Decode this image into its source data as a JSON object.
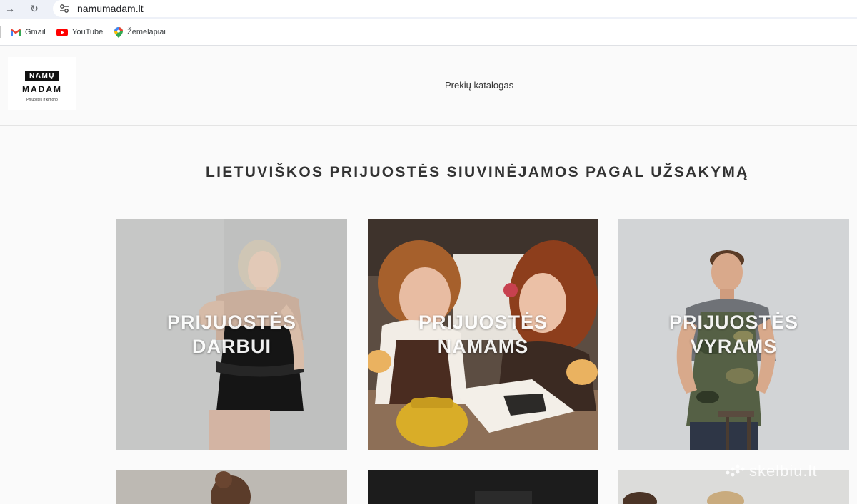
{
  "browser": {
    "url": "namumadam.lt",
    "bookmarks": [
      {
        "label": "Gmail",
        "icon": "gmail-icon"
      },
      {
        "label": "YouTube",
        "icon": "youtube-icon"
      },
      {
        "label": "Žemėlapiai",
        "icon": "maps-pin-icon"
      }
    ]
  },
  "header": {
    "logo": {
      "top": "NAMŲ",
      "main": "MADAM",
      "sub": "Prijuostės ir kimono"
    },
    "nav_link": "Prekių katalogas"
  },
  "main": {
    "headline": "LIETUVIŠKOS PRIJUOSTĖS SIUVINĖJAMOS PAGAL UŽSAKYMĄ",
    "categories": [
      {
        "line1": "PRIJUOSTĖS",
        "line2": "DARBUI"
      },
      {
        "line1": "PRIJUOSTĖS",
        "line2": "NAMAMS"
      },
      {
        "line1": "PRIJUOSTĖS",
        "line2": "VYRAMS"
      }
    ]
  },
  "watermark": "skelbiu.lt",
  "colors": {
    "page_bg": "#fafafa",
    "addressbar_bg": "#eef1f8",
    "text_dark": "#333333"
  }
}
